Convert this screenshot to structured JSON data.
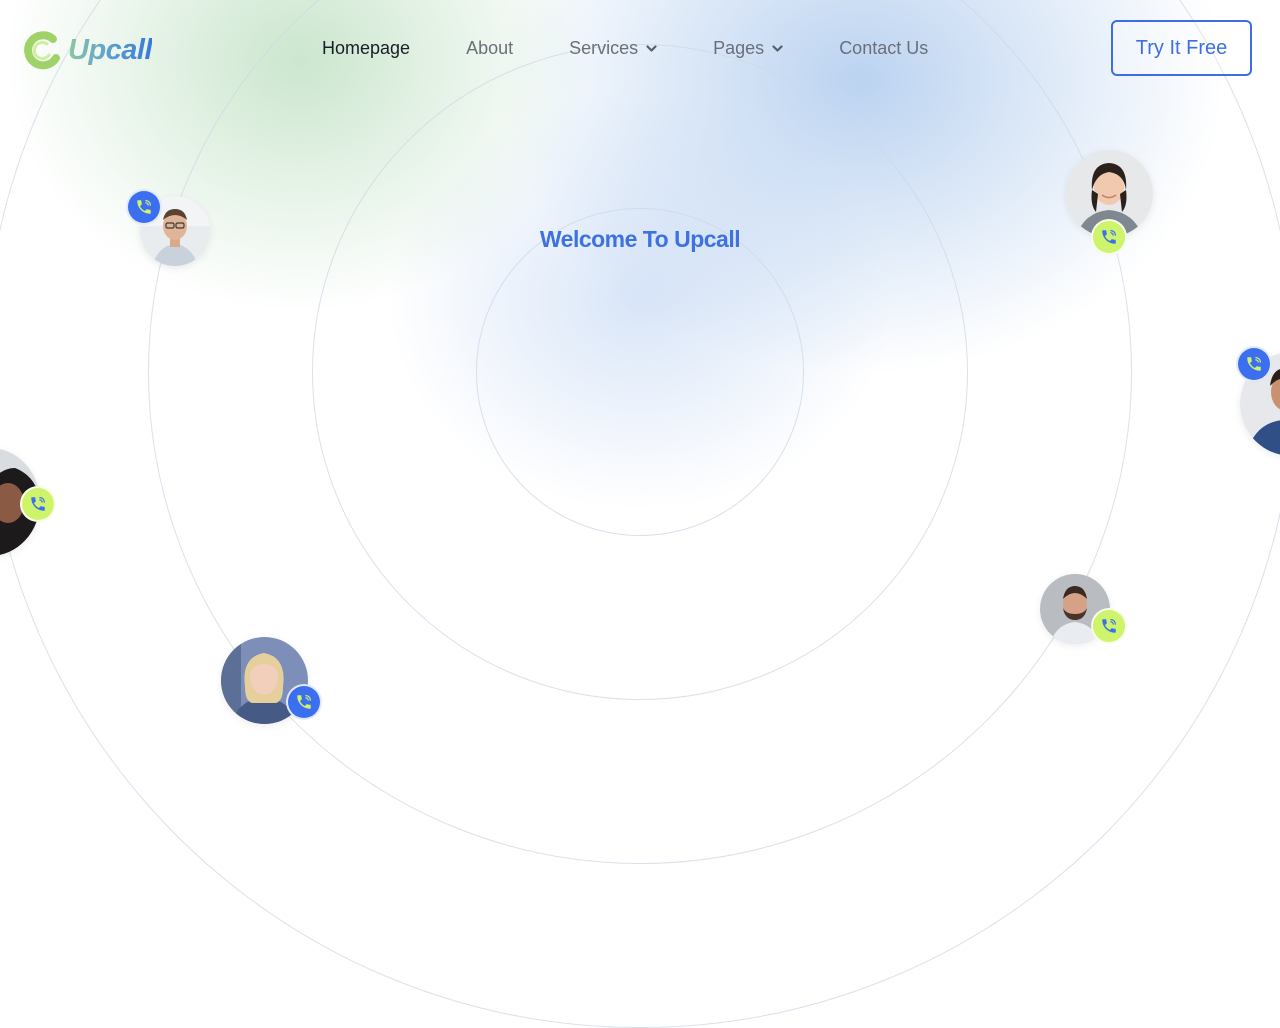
{
  "brand": {
    "name": "Upcall"
  },
  "nav": {
    "items": [
      {
        "label": "Homepage",
        "active": true,
        "has_dropdown": false
      },
      {
        "label": "About",
        "active": false,
        "has_dropdown": false
      },
      {
        "label": "Services",
        "active": false,
        "has_dropdown": true
      },
      {
        "label": "Pages",
        "active": false,
        "has_dropdown": true
      },
      {
        "label": "Contact Us",
        "active": false,
        "has_dropdown": false
      }
    ],
    "cta_label": "Try It Free"
  },
  "hero": {
    "headline": "Welcome To Upcall"
  },
  "colors": {
    "accent": "#3d6fe3",
    "badge_blue": "#3c6ff0",
    "badge_lime": "#cdf46a",
    "nav_text": "#6b6f7a",
    "nav_active": "#1a1d26"
  },
  "icons": {
    "logo": "c-logo-mark",
    "dropdown": "chevron-down-icon",
    "call": "phone-call-icon"
  }
}
